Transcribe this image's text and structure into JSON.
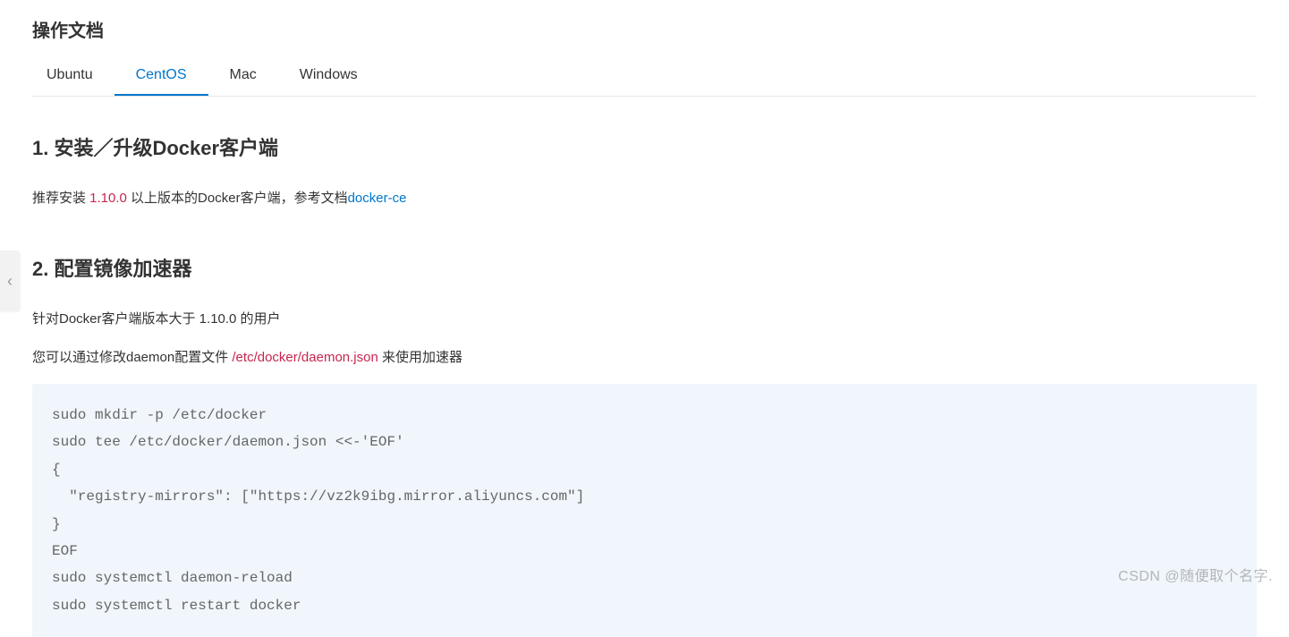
{
  "page": {
    "title": "操作文档"
  },
  "tabs": {
    "items": [
      {
        "label": "Ubuntu"
      },
      {
        "label": "CentOS"
      },
      {
        "label": "Mac"
      },
      {
        "label": "Windows"
      }
    ],
    "activeIndex": 1
  },
  "section1": {
    "heading": "1. 安装／升级Docker客户端",
    "text_before": "推荐安装 ",
    "version": "1.10.0",
    "text_mid": " 以上版本的Docker客户端，参考文档",
    "link": "docker-ce"
  },
  "section2": {
    "heading": "2. 配置镜像加速器",
    "para1": "针对Docker客户端版本大于 1.10.0 的用户",
    "para2_before": "您可以通过修改daemon配置文件 ",
    "para2_path": "/etc/docker/daemon.json",
    "para2_after": " 来使用加速器",
    "code": "sudo mkdir -p /etc/docker\nsudo tee /etc/docker/daemon.json <<-'EOF'\n{\n  \"registry-mirrors\": [\"https://vz2k9ibg.mirror.aliyuncs.com\"]\n}\nEOF\nsudo systemctl daemon-reload\nsudo systemctl restart docker"
  },
  "sideHandle": {
    "glyph": "‹"
  },
  "watermark": {
    "text": "CSDN @随便取个名字."
  }
}
